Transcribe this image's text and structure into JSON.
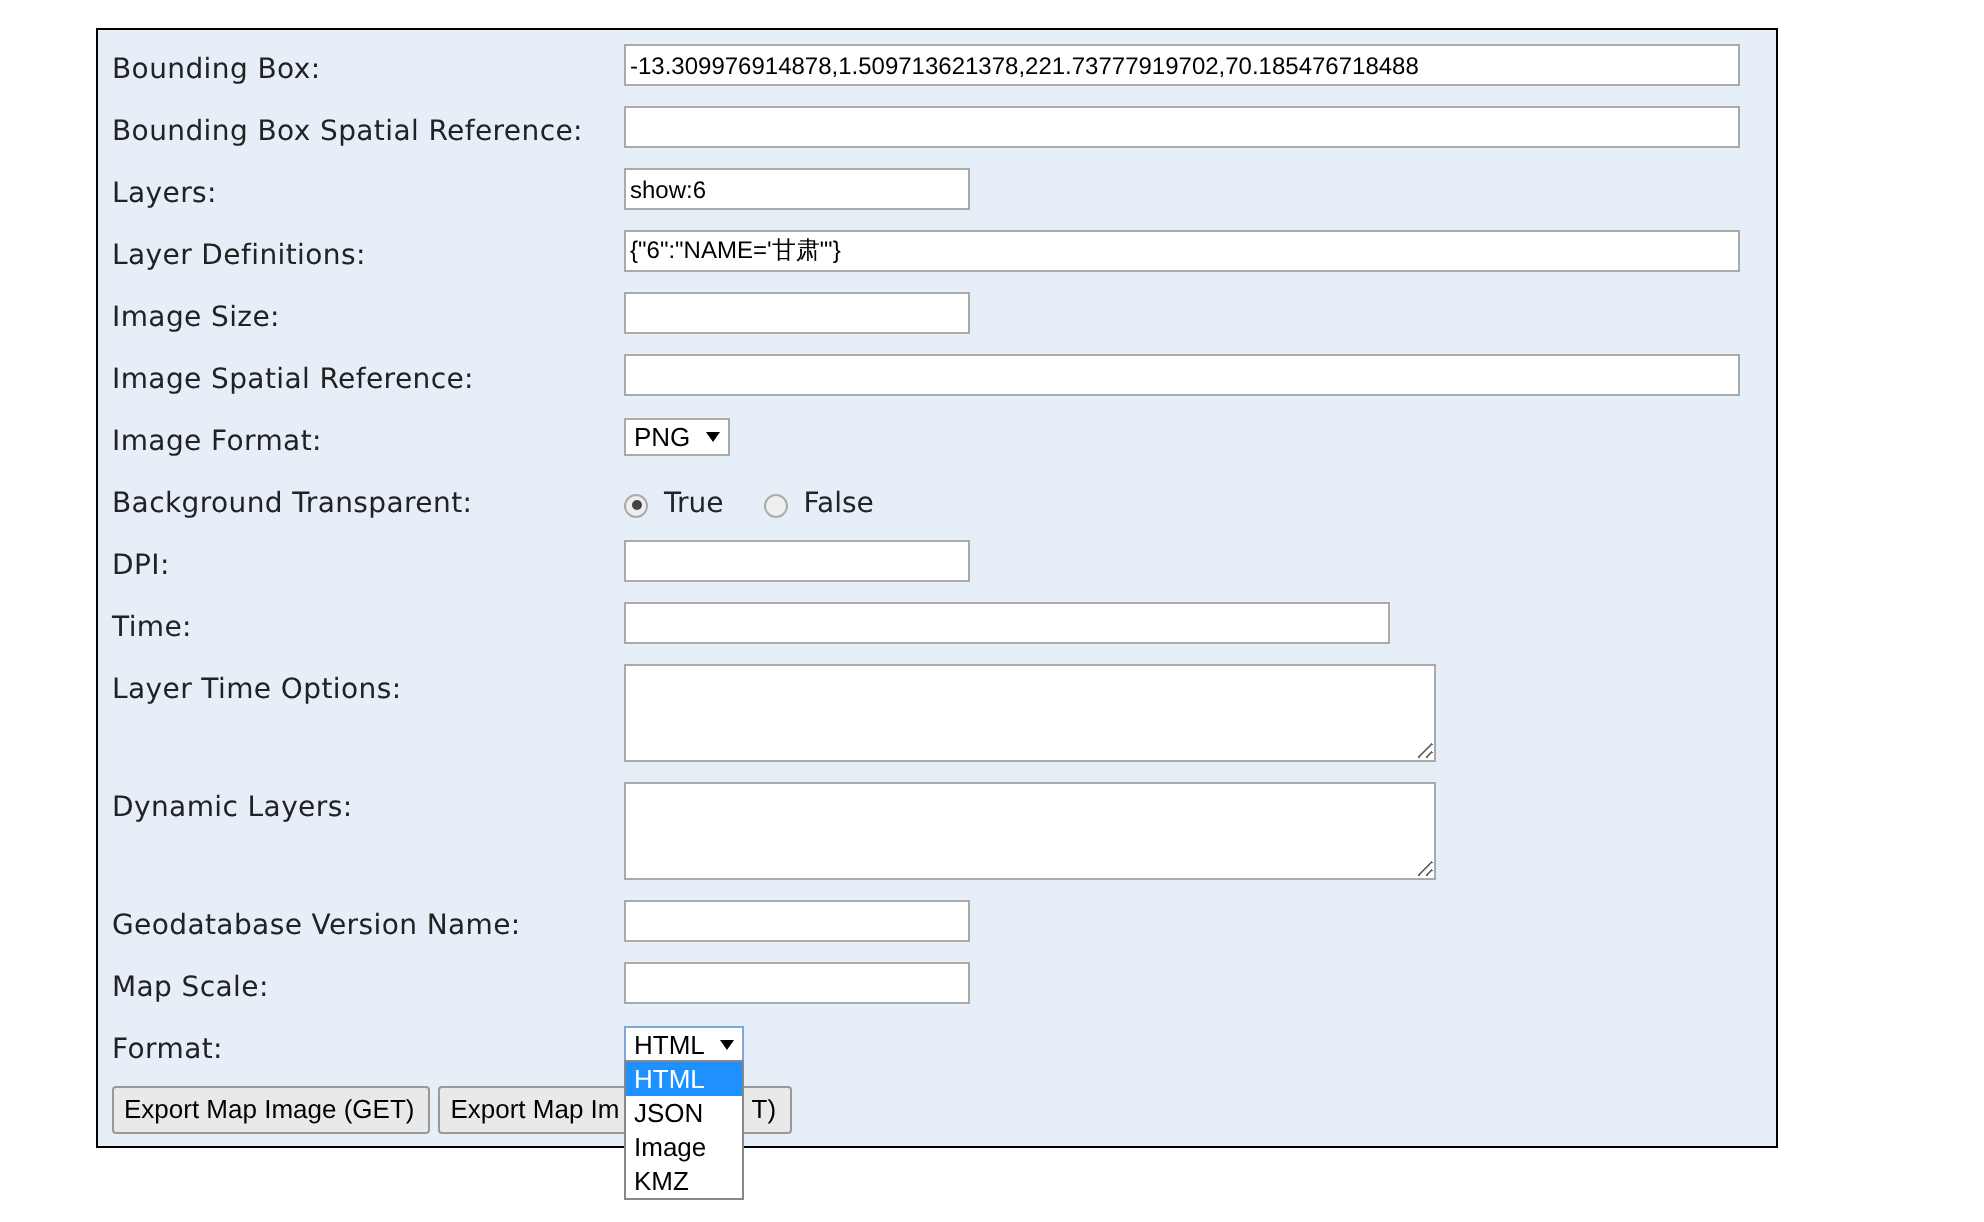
{
  "fields": [
    {
      "label": "Bounding Box:",
      "kind": "wide",
      "value": "-13.309976914878,1.509713621378,221.73777919702,70.185476718488"
    },
    {
      "label": "Bounding Box Spatial Reference:",
      "kind": "wide"
    },
    {
      "label": "Layers:",
      "kind": "short",
      "value": "show:6"
    },
    {
      "label": "Layer Definitions:",
      "kind": "wide",
      "value": "{\"6\":\"NAME='甘肃'\"}"
    },
    {
      "label": "Image Size:",
      "kind": "short"
    },
    {
      "label": "Image Spatial Reference:",
      "kind": "wide"
    },
    {
      "label": "Image Format:",
      "kind": "select",
      "value": "PNG"
    },
    {
      "label": "Background Transparent:",
      "kind": "radio",
      "options": [
        {
          "label": "True",
          "selected": true
        },
        {
          "label": "False",
          "selected": false
        }
      ]
    },
    {
      "label": "DPI:",
      "kind": "short"
    },
    {
      "label": "Time:",
      "kind": "medium"
    },
    {
      "label": "Layer Time Options:",
      "kind": "area"
    },
    {
      "label": "Dynamic Layers:",
      "kind": "area"
    },
    {
      "label": "Geodatabase Version Name:",
      "kind": "short"
    },
    {
      "label": "Map Scale:",
      "kind": "short"
    },
    {
      "label": "Format:",
      "kind": "dropdown",
      "value": "HTML",
      "options": [
        {
          "label": "HTML",
          "selected": true
        },
        {
          "label": "JSON",
          "selected": false
        },
        {
          "label": "Image",
          "selected": false
        },
        {
          "label": "KMZ",
          "selected": false
        }
      ]
    }
  ],
  "buttons": [
    {
      "label": "Export Map Image (GET)"
    },
    {
      "label": "Export Map Im",
      "tail": "T)"
    }
  ]
}
